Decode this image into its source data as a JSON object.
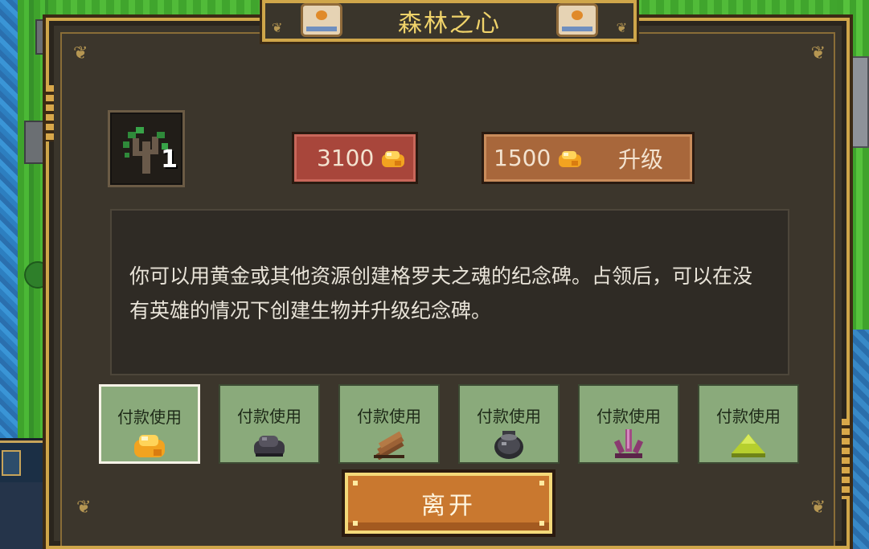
{
  "dialog": {
    "title": "森林之心"
  },
  "building": {
    "level": "1",
    "icon": "dead-tree-icon"
  },
  "cost_buttons": {
    "build_cost": "3100",
    "upgrade_cost": "1500",
    "upgrade_label": "升级",
    "currency_icon": "gold-icon"
  },
  "description": {
    "text": "你可以用黄金或其他资源创建格罗夫之魂的纪念碑。占领后，可以在没有英雄的情况下创建生物并升级纪念碑。"
  },
  "payment_options": [
    {
      "label": "付款使用",
      "icon": "gold-icon",
      "selected": true
    },
    {
      "label": "付款使用",
      "icon": "ore-icon",
      "selected": false
    },
    {
      "label": "付款使用",
      "icon": "wood-icon",
      "selected": false
    },
    {
      "label": "付款使用",
      "icon": "mercury-icon",
      "selected": false
    },
    {
      "label": "付款使用",
      "icon": "crystal-icon",
      "selected": false
    },
    {
      "label": "付款使用",
      "icon": "sulfur-icon",
      "selected": false
    }
  ],
  "leave_button": {
    "label": "离开"
  },
  "colors": {
    "title": "#f0d36a",
    "frame_gold": "#cfa64a",
    "build_button": "#a8463b",
    "upgrade_button": "#a8673b",
    "payment_bg": "#8aaa7b",
    "leave_button": "#c9782f"
  }
}
